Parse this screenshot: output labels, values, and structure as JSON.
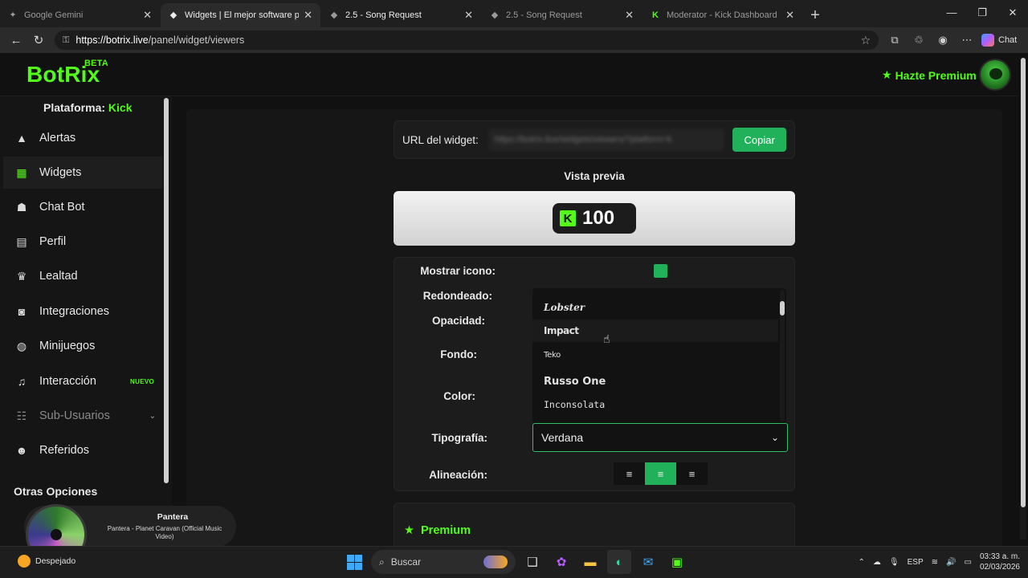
{
  "browser": {
    "tabs": [
      {
        "title": "Google Gemini",
        "active": false,
        "favicon": "gemini-icon"
      },
      {
        "title": "Widgets | El mejor software para p",
        "active": true,
        "favicon": "botrix-icon"
      },
      {
        "title": "2.5 - Song Request",
        "active": false,
        "favicon": "botrix-icon"
      },
      {
        "title": "2.5 - Song Request",
        "active": false,
        "favicon": "botrix-icon"
      },
      {
        "title": "Moderator - Kick Dashboard",
        "active": false,
        "favicon": "kick-icon"
      }
    ],
    "url_host": "https://botrix.live",
    "url_path": "/panel/widget/viewers",
    "copilot_label": "Chat"
  },
  "header": {
    "brand": "BotRix",
    "beta": "BETA",
    "premium_link": "Hazte Premium"
  },
  "sidebar": {
    "platform_label": "Plataforma:",
    "platform_value": "Kick",
    "items": [
      {
        "label": "Alertas",
        "icon": "warning-icon"
      },
      {
        "label": "Widgets",
        "icon": "grid-icon",
        "active": true
      },
      {
        "label": "Chat Bot",
        "icon": "robot-icon"
      },
      {
        "label": "Perfil",
        "icon": "id-card-icon"
      },
      {
        "label": "Lealtad",
        "icon": "trophy-icon"
      },
      {
        "label": "Integraciones",
        "icon": "discord-icon"
      },
      {
        "label": "Minijuegos",
        "icon": "gamepad-icon"
      },
      {
        "label": "Interacción",
        "icon": "music-icon",
        "badge": "NUEVO"
      },
      {
        "label": "Sub-Usuarios",
        "icon": "users-icon",
        "disabled": true
      },
      {
        "label": "Referidos",
        "icon": "people-icon"
      }
    ],
    "other_title": "Otras Opciones"
  },
  "widget": {
    "url_label": "URL del widget:",
    "url_value": "https://botrix.live/widgets/viewers/?platform=k",
    "copy_button": "Copiar",
    "preview_title": "Vista previa",
    "preview_count": "100"
  },
  "settings": {
    "show_icon": "Mostrar icono:",
    "rounded": "Redondeado:",
    "opacity": "Opacidad:",
    "background": "Fondo:",
    "color": "Color:",
    "typography": "Tipografía:",
    "alignment": "Alineación:",
    "selected_font": "Verdana",
    "font_options": [
      "Lobster",
      "Impact",
      "Teko",
      "Russo One",
      "Inconsolata"
    ]
  },
  "premium": {
    "title": "Premium"
  },
  "media": {
    "title": "Pantera",
    "subtitle": "Pantera - Planet Caravan (Official Music Video)"
  },
  "taskbar": {
    "weather": "Despejado",
    "search_placeholder": "Buscar",
    "lang": "ESP",
    "time": "03:33 a. m.",
    "date": "02/03/2026"
  },
  "colors": {
    "accent": "#53fc18",
    "button_green": "#21b15a",
    "background": "#111111"
  }
}
